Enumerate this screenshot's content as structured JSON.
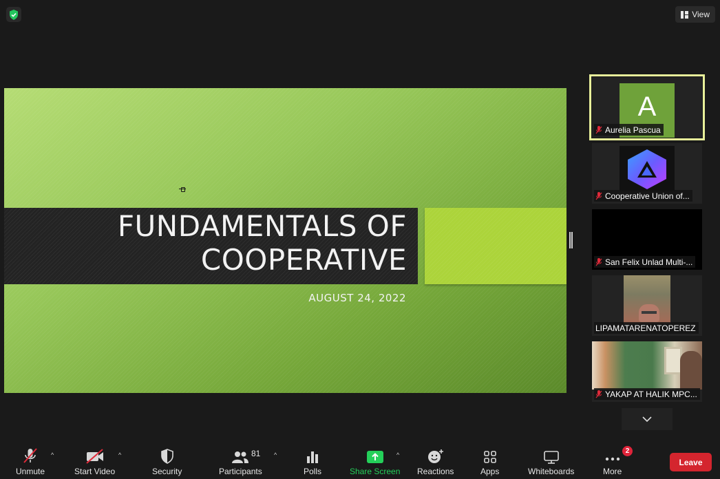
{
  "top_bar": {
    "view_label": "View"
  },
  "slide": {
    "title": "FUNDAMENTALS OF\nCOOPERATIVE",
    "date": "AUGUST 24, 2022"
  },
  "participants": [
    {
      "name": "Aurelia Pascua",
      "avatar_letter": "A",
      "muted": true,
      "active": true
    },
    {
      "name": "Cooperative Union of...",
      "muted": true
    },
    {
      "name": "San Felix Unlad Multi-...",
      "muted": true
    },
    {
      "name": "LIPAMATARENATOPEREZ",
      "muted": false
    },
    {
      "name": "YAKAP AT HALIK MPC...",
      "muted": true
    }
  ],
  "toolbar": {
    "unmute": "Unmute",
    "start_video": "Start Video",
    "security": "Security",
    "participants": "Participants",
    "participants_count": "81",
    "polls": "Polls",
    "share_screen": "Share Screen",
    "reactions": "Reactions",
    "apps": "Apps",
    "whiteboards": "Whiteboards",
    "more": "More",
    "more_badge": "2",
    "leave": "Leave"
  },
  "colors": {
    "share_green": "#24d05a",
    "leave_red": "#d4252e",
    "active_speaker_outline": "#e8f09a",
    "slide_accent": "#acd43a",
    "avatar_green": "#6fa23a"
  }
}
